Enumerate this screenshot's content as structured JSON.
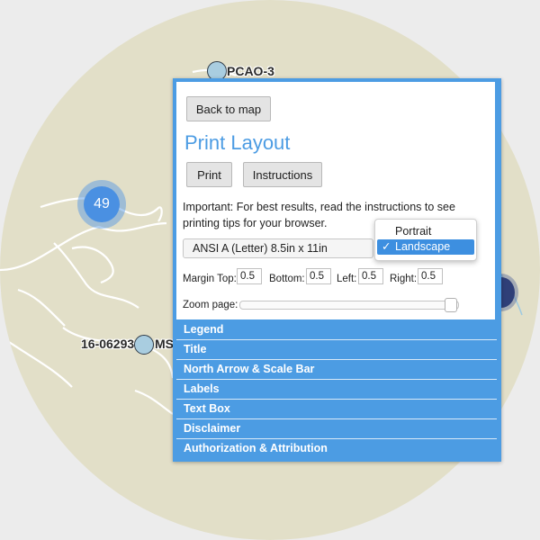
{
  "map": {
    "cluster_count": "49",
    "labels": {
      "pcao3": "PCAO-3",
      "ms_site": "16-06293",
      "ms_suffix": "MS"
    },
    "colors": {
      "land": "#e2dfc8",
      "roads": "#ffffff",
      "cluster": "#4a90e2",
      "marker": "#a9cde0"
    }
  },
  "print_panel": {
    "back_button": "Back to map",
    "title": "Print Layout",
    "print_button": "Print",
    "instructions_button": "Instructions",
    "notice_strong": "Important:",
    "notice_text": " For best results, read the instructions to see printing tips for your browser.",
    "paper_size": "ANSI A (Letter) 8.5in x 11in",
    "orientation_options": [
      "Portrait",
      "Landscape"
    ],
    "orientation_selected": "Landscape",
    "check_mark": "✓",
    "margins": {
      "top_label": "Margin Top:",
      "top": "0.5",
      "bottom_label": "Bottom:",
      "bottom": "0.5",
      "left_label": "Left:",
      "left": "0.5",
      "right_label": "Right:",
      "right": "0.5"
    },
    "zoom_label": "Zoom page:",
    "zoom_value": 0.99,
    "sections": [
      "Legend",
      "Title",
      "North Arrow & Scale Bar",
      "Labels",
      "Text Box",
      "Disclaimer",
      "Authorization & Attribution"
    ],
    "accent_color": "#4c9ce3"
  }
}
